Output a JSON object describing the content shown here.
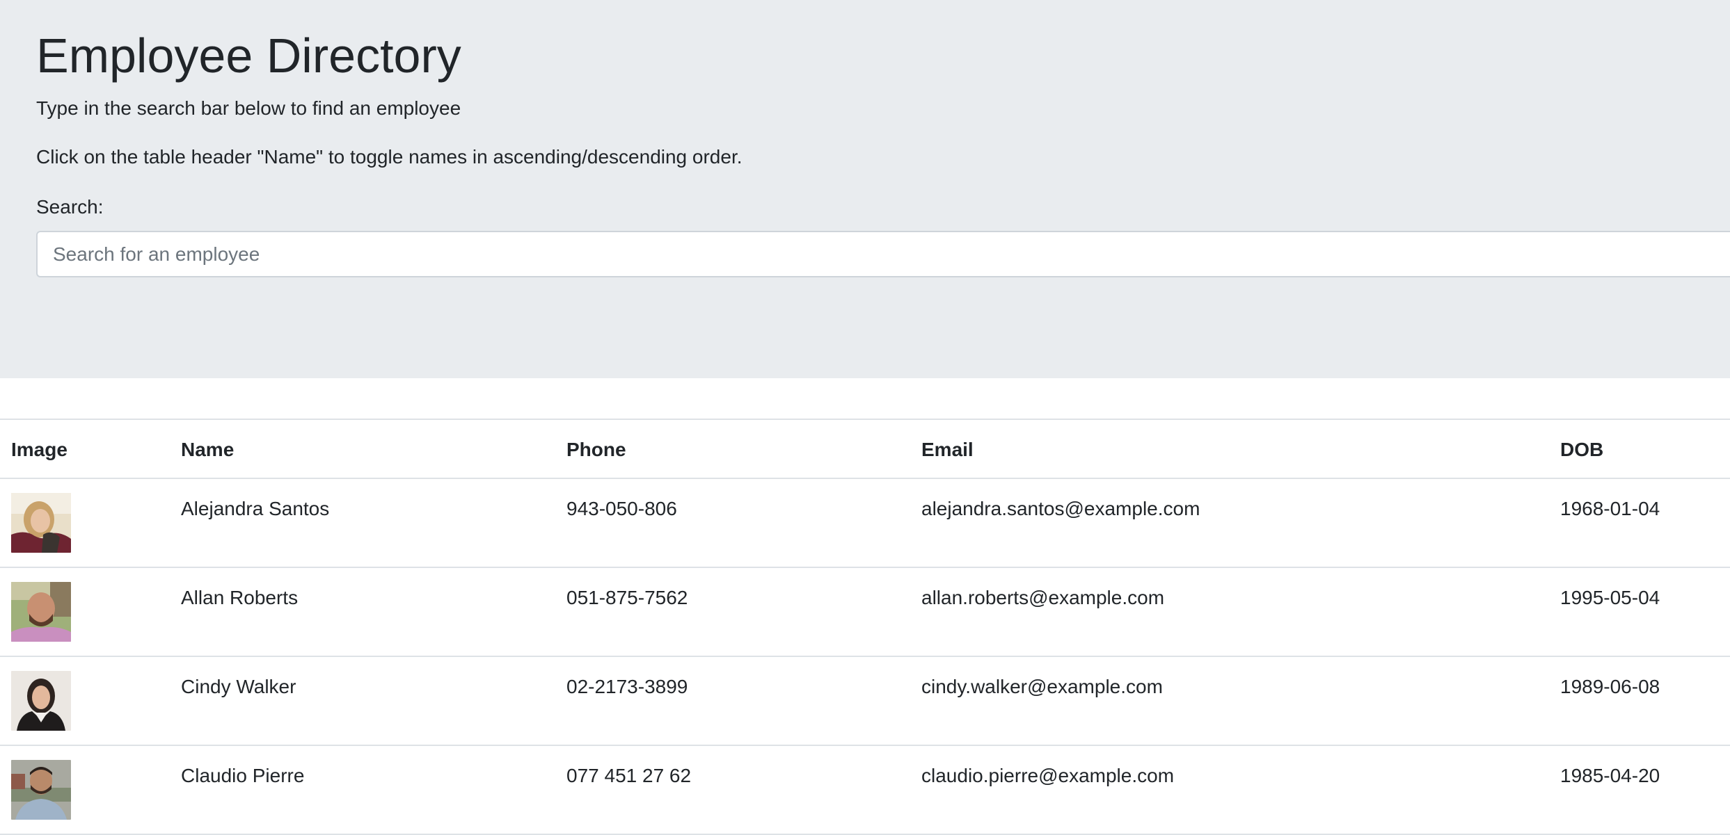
{
  "header": {
    "title": "Employee Directory",
    "instruction_search": "Type in the search bar below to find an employee",
    "instruction_sort": "Click on the table header \"Name\" to toggle names in ascending/descending order.",
    "search_label": "Search:",
    "search_placeholder": "Search for an employee",
    "search_value": ""
  },
  "table": {
    "columns": [
      "Image",
      "Name",
      "Phone",
      "Email",
      "DOB"
    ],
    "rows": [
      {
        "name": "Alejandra Santos",
        "phone": "943-050-806",
        "email": "alejandra.santos@example.com",
        "dob": "1968-01-04",
        "avatar_icon": "person-photo-icon"
      },
      {
        "name": "Allan Roberts",
        "phone": "051-875-7562",
        "email": "allan.roberts@example.com",
        "dob": "1995-05-04",
        "avatar_icon": "person-photo-icon"
      },
      {
        "name": "Cindy Walker",
        "phone": "02-2173-3899",
        "email": "cindy.walker@example.com",
        "dob": "1989-06-08",
        "avatar_icon": "person-photo-icon"
      },
      {
        "name": "Claudio Pierre",
        "phone": "077 451 27 62",
        "email": "claudio.pierre@example.com",
        "dob": "1985-04-20",
        "avatar_icon": "person-photo-icon"
      }
    ]
  },
  "colors": {
    "jumbotron_bg": "#e9ecef",
    "text": "#212529",
    "border": "#dee2e6"
  }
}
